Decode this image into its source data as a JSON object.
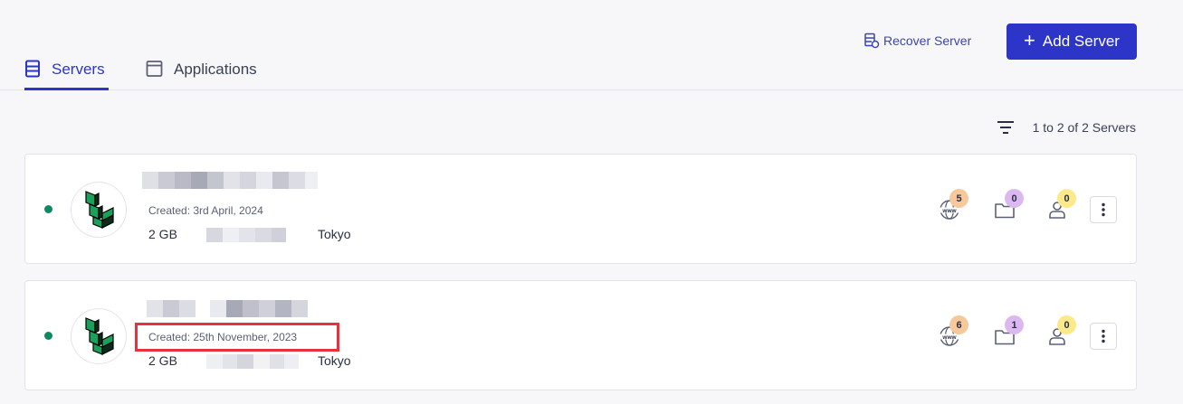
{
  "tabs": [
    {
      "label": "Servers",
      "icon": "server-icon",
      "active": true
    },
    {
      "label": "Applications",
      "icon": "browser-window-icon",
      "active": false
    }
  ],
  "header": {
    "recover_label": "Recover Server",
    "add_label": "Add Server",
    "accent": "#2d35c8"
  },
  "list": {
    "count_text": "1 to 2 of 2 Servers",
    "filter_icon": "filter-icon"
  },
  "servers": [
    {
      "status": "online",
      "created": "Created: 3rd April, 2024",
      "size": "2 GB",
      "region": "Tokyo",
      "stats": {
        "websites": "5",
        "folders": "0",
        "users": "0"
      }
    },
    {
      "status": "online",
      "created": "Created: 25th November, 2023",
      "size": "2 GB",
      "region": "Tokyo",
      "stats": {
        "websites": "6",
        "folders": "1",
        "users": "0"
      }
    }
  ],
  "colors": {
    "badge_websites": "#f7c89a",
    "badge_folders": "#dcb8f0",
    "badge_users": "#fbe98a",
    "status_online": "#0f8a5f",
    "highlight": "#e8313b"
  }
}
